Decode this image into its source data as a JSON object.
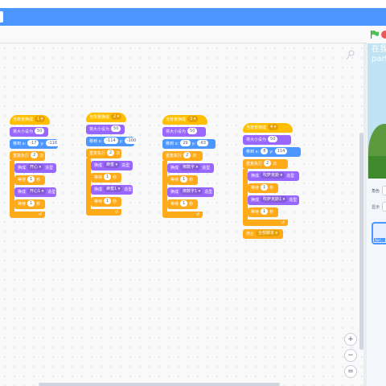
{
  "stage": {
    "title": "在我\npart"
  },
  "sprite_panel": {
    "label_role": "角色",
    "label_x": "x",
    "label_show": "显示",
    "sprite_name": "Spri..."
  },
  "controls": {
    "zoom_in": "+",
    "zoom_out": "−",
    "reset": "="
  },
  "colors": {
    "menubar": "#4c97ff",
    "events": "#ffbf00",
    "looks": "#9966ff",
    "motion": "#4c97ff",
    "control": "#ffab19"
  },
  "scripts": [
    {
      "hat": "当背景换成",
      "hat_value": "1",
      "size_label": "将大小设为",
      "size": "50",
      "goto_label_x": "移到 x:",
      "x": "-17",
      "goto_label_y": "y:",
      "y": "-116",
      "repeat_label": "重复执行",
      "repeat": "2",
      "repeat_unit": "次",
      "body": [
        {
          "kind": "looks",
          "pre": "换成",
          "dd": "开心",
          "post": "造型"
        },
        {
          "kind": "control",
          "pre": "等待",
          "val": "1",
          "post": "秒"
        },
        {
          "kind": "looks",
          "pre": "换成",
          "dd": "开心1",
          "post": "造型"
        },
        {
          "kind": "control",
          "pre": "等待",
          "val": "1",
          "post": "秒"
        }
      ]
    },
    {
      "hat": "当背景换成",
      "hat_value": "2",
      "size_label": "将大小设为",
      "size": "50",
      "goto_label_x": "移到 x:",
      "x": "-114",
      "goto_label_y": "y:",
      "y": "-100",
      "repeat_label": "重复执行",
      "repeat": "2",
      "repeat_unit": "次",
      "body": [
        {
          "kind": "looks",
          "pre": "换成",
          "dd": "蜂蜜",
          "post": "造型"
        },
        {
          "kind": "control",
          "pre": "等待",
          "val": "1",
          "post": "秒"
        },
        {
          "kind": "looks",
          "pre": "换成",
          "dd": "蜂蜜1",
          "post": "造型"
        },
        {
          "kind": "control",
          "pre": "等待",
          "val": "1",
          "post": "秒"
        }
      ]
    },
    {
      "hat": "当背景换成",
      "hat_value": "3",
      "size_label": "将大小设为",
      "size": "50",
      "goto_label_x": "移到 x:",
      "x": "29",
      "goto_label_y": "y:",
      "y": "-63",
      "repeat_label": "重复执行",
      "repeat": "2",
      "repeat_unit": "次",
      "body": [
        {
          "kind": "looks",
          "pre": "换成",
          "dd": "擦数字",
          "post": "造型"
        },
        {
          "kind": "control",
          "pre": "等待",
          "val": "1",
          "post": "秒"
        },
        {
          "kind": "looks",
          "pre": "换成",
          "dd": "擦数字1",
          "post": "造型"
        },
        {
          "kind": "control",
          "pre": "等待",
          "val": "1",
          "post": "秒"
        }
      ]
    },
    {
      "hat": "当背景换成",
      "hat_value": "4",
      "size_label": "将大小设为",
      "size": "50",
      "goto_label_x": "移到 x:",
      "x": "8",
      "goto_label_y": "y:",
      "y": "114",
      "repeat_label": "重复执行",
      "repeat": "2",
      "repeat_unit": "次",
      "body": [
        {
          "kind": "looks",
          "pre": "换成",
          "dd": "吹萨克斯",
          "post": "造型"
        },
        {
          "kind": "control",
          "pre": "等待",
          "val": "1",
          "post": "秒"
        },
        {
          "kind": "looks",
          "pre": "换成",
          "dd": "吹萨克斯1",
          "post": "造型"
        },
        {
          "kind": "control",
          "pre": "等待",
          "val": "1",
          "post": "秒"
        }
      ],
      "stop_label": "停止",
      "stop_value": "全部脚本"
    }
  ]
}
